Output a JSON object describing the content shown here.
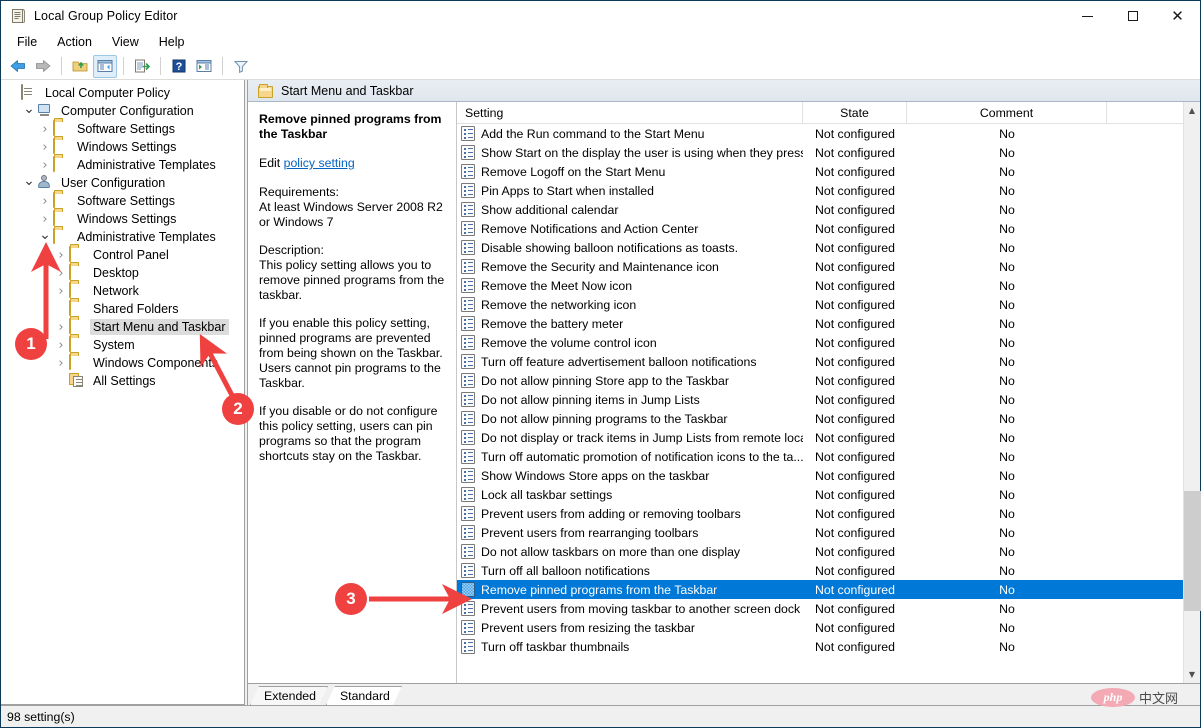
{
  "window": {
    "title": "Local Group Policy Editor",
    "app_icon": "policy-document-icon",
    "minimize_label": "Minimize",
    "maximize_label": "Maximize",
    "close_label": "Close"
  },
  "menubar": {
    "items": [
      {
        "label": "File"
      },
      {
        "label": "Action"
      },
      {
        "label": "View"
      },
      {
        "label": "Help"
      }
    ]
  },
  "toolbar": {
    "buttons": [
      {
        "name": "back-button",
        "icon": "left-arrow-icon"
      },
      {
        "name": "forward-button",
        "icon": "right-arrow-icon"
      },
      {
        "name": "up-one-level-button",
        "icon": "folder-up-icon"
      },
      {
        "name": "show-hide-console-tree-button",
        "icon": "console-tree-icon"
      },
      {
        "name": "export-list-button",
        "icon": "export-list-icon"
      },
      {
        "name": "help-button",
        "icon": "question-mark-icon"
      },
      {
        "name": "show-hide-action-pane-button",
        "icon": "action-pane-icon"
      },
      {
        "name": "filter-button",
        "icon": "funnel-icon"
      }
    ]
  },
  "tree": {
    "items": [
      {
        "label": "Local Computer Policy",
        "icon": "policy-document-icon",
        "indent": 0,
        "twisty": "none",
        "selected": false
      },
      {
        "label": "Computer Configuration",
        "icon": "computer-icon",
        "indent": 1,
        "twisty": "open",
        "selected": false
      },
      {
        "label": "Software Settings",
        "icon": "folder-icon",
        "indent": 2,
        "twisty": "closed",
        "selected": false
      },
      {
        "label": "Windows Settings",
        "icon": "folder-icon",
        "indent": 2,
        "twisty": "closed",
        "selected": false
      },
      {
        "label": "Administrative Templates",
        "icon": "folder-icon",
        "indent": 2,
        "twisty": "closed",
        "selected": false
      },
      {
        "label": "User Configuration",
        "icon": "user-icon",
        "indent": 1,
        "twisty": "open",
        "selected": false
      },
      {
        "label": "Software Settings",
        "icon": "folder-icon",
        "indent": 2,
        "twisty": "closed",
        "selected": false
      },
      {
        "label": "Windows Settings",
        "icon": "folder-icon",
        "indent": 2,
        "twisty": "closed",
        "selected": false
      },
      {
        "label": "Administrative Templates",
        "icon": "folder-icon",
        "indent": 2,
        "twisty": "open",
        "selected": false
      },
      {
        "label": "Control Panel",
        "icon": "folder-icon",
        "indent": 3,
        "twisty": "closed",
        "selected": false
      },
      {
        "label": "Desktop",
        "icon": "folder-icon",
        "indent": 3,
        "twisty": "closed",
        "selected": false
      },
      {
        "label": "Network",
        "icon": "folder-icon",
        "indent": 3,
        "twisty": "closed",
        "selected": false
      },
      {
        "label": "Shared Folders",
        "icon": "folder-icon",
        "indent": 3,
        "twisty": "none",
        "selected": false
      },
      {
        "label": "Start Menu and Taskbar",
        "icon": "folder-icon",
        "indent": 3,
        "twisty": "closed",
        "selected": true
      },
      {
        "label": "System",
        "icon": "folder-icon",
        "indent": 3,
        "twisty": "closed",
        "selected": false
      },
      {
        "label": "Windows Components",
        "icon": "folder-icon",
        "indent": 3,
        "twisty": "closed",
        "selected": false
      },
      {
        "label": "All Settings",
        "icon": "all-settings-icon",
        "indent": 3,
        "twisty": "none",
        "selected": false
      }
    ]
  },
  "right_pane": {
    "header_title": "Start Menu and Taskbar",
    "header_icon": "folder-icon"
  },
  "description": {
    "title": "Remove pinned programs from the Taskbar",
    "edit_prefix": "Edit ",
    "edit_link": "policy setting",
    "requirements_label": "Requirements:",
    "requirements_text": "At least Windows Server 2008 R2 or Windows 7",
    "description_label": "Description:",
    "description_text": "This policy setting allows you to remove pinned programs from the taskbar.",
    "enable_text": "If you enable this policy setting, pinned programs are prevented from being shown on the Taskbar. Users cannot pin programs to the Taskbar.",
    "disable_text": "If you disable or do not configure this policy setting, users can pin programs so that the program shortcuts stay on the Taskbar."
  },
  "list": {
    "columns": [
      "Setting",
      "State",
      "Comment"
    ],
    "rows": [
      {
        "setting": "Add the Run command to the Start Menu",
        "state": "Not configured",
        "comment": "No",
        "selected": false
      },
      {
        "setting": "Show Start on the display the user is using when they press t...",
        "state": "Not configured",
        "comment": "No",
        "selected": false
      },
      {
        "setting": "Remove Logoff on the Start Menu",
        "state": "Not configured",
        "comment": "No",
        "selected": false
      },
      {
        "setting": "Pin Apps to Start when installed",
        "state": "Not configured",
        "comment": "No",
        "selected": false
      },
      {
        "setting": "Show additional calendar",
        "state": "Not configured",
        "comment": "No",
        "selected": false
      },
      {
        "setting": "Remove Notifications and Action Center",
        "state": "Not configured",
        "comment": "No",
        "selected": false
      },
      {
        "setting": "Disable showing balloon notifications as toasts.",
        "state": "Not configured",
        "comment": "No",
        "selected": false
      },
      {
        "setting": "Remove the Security and Maintenance icon",
        "state": "Not configured",
        "comment": "No",
        "selected": false
      },
      {
        "setting": "Remove the Meet Now icon",
        "state": "Not configured",
        "comment": "No",
        "selected": false
      },
      {
        "setting": "Remove the networking icon",
        "state": "Not configured",
        "comment": "No",
        "selected": false
      },
      {
        "setting": "Remove the battery meter",
        "state": "Not configured",
        "comment": "No",
        "selected": false
      },
      {
        "setting": "Remove the volume control icon",
        "state": "Not configured",
        "comment": "No",
        "selected": false
      },
      {
        "setting": "Turn off feature advertisement balloon notifications",
        "state": "Not configured",
        "comment": "No",
        "selected": false
      },
      {
        "setting": "Do not allow pinning Store app to the Taskbar",
        "state": "Not configured",
        "comment": "No",
        "selected": false
      },
      {
        "setting": "Do not allow pinning items in Jump Lists",
        "state": "Not configured",
        "comment": "No",
        "selected": false
      },
      {
        "setting": "Do not allow pinning programs to the Taskbar",
        "state": "Not configured",
        "comment": "No",
        "selected": false
      },
      {
        "setting": "Do not display or track items in Jump Lists from remote loca...",
        "state": "Not configured",
        "comment": "No",
        "selected": false
      },
      {
        "setting": "Turn off automatic promotion of notification icons to the ta...",
        "state": "Not configured",
        "comment": "No",
        "selected": false
      },
      {
        "setting": "Show Windows Store apps on the taskbar",
        "state": "Not configured",
        "comment": "No",
        "selected": false
      },
      {
        "setting": "Lock all taskbar settings",
        "state": "Not configured",
        "comment": "No",
        "selected": false
      },
      {
        "setting": "Prevent users from adding or removing toolbars",
        "state": "Not configured",
        "comment": "No",
        "selected": false
      },
      {
        "setting": "Prevent users from rearranging toolbars",
        "state": "Not configured",
        "comment": "No",
        "selected": false
      },
      {
        "setting": "Do not allow taskbars on more than one display",
        "state": "Not configured",
        "comment": "No",
        "selected": false
      },
      {
        "setting": "Turn off all balloon notifications",
        "state": "Not configured",
        "comment": "No",
        "selected": false
      },
      {
        "setting": "Remove pinned programs from the Taskbar",
        "state": "Not configured",
        "comment": "No",
        "selected": true
      },
      {
        "setting": "Prevent users from moving taskbar to another screen dock l...",
        "state": "Not configured",
        "comment": "No",
        "selected": false
      },
      {
        "setting": "Prevent users from resizing the taskbar",
        "state": "Not configured",
        "comment": "No",
        "selected": false
      },
      {
        "setting": "Turn off taskbar thumbnails",
        "state": "Not configured",
        "comment": "No",
        "selected": false
      }
    ]
  },
  "tabs": [
    {
      "label": "Extended",
      "active": false
    },
    {
      "label": "Standard",
      "active": true
    }
  ],
  "statusbar": {
    "text": "98 setting(s)"
  },
  "annotations": [
    {
      "number": "1",
      "target": "administrative-templates-tree-node"
    },
    {
      "number": "2",
      "target": "start-menu-and-taskbar-tree-node"
    },
    {
      "number": "3",
      "target": "remove-pinned-programs-from-the-taskbar-row"
    }
  ],
  "watermark": {
    "logo_text": "php",
    "site_text": "中文网"
  },
  "colors": {
    "selection_blue": "#0078d7",
    "annotation_red": "#f04141",
    "link_blue": "#0563c1",
    "folder_yellow": "#f6d68a",
    "titlebar_border": "#0e3a5a"
  }
}
